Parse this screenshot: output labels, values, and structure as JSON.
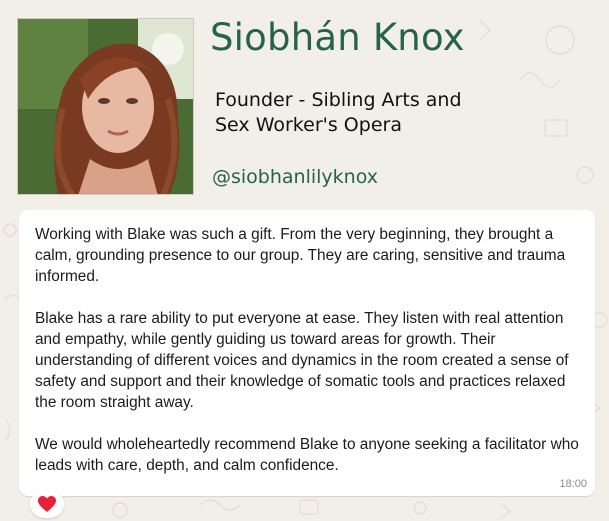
{
  "profile": {
    "name": "Siobhán Knox",
    "role_line1": "Founder - Sibling Arts and",
    "role_line2": "Sex Worker's Opera",
    "handle": "@siobhanlilyknox"
  },
  "message": {
    "paragraphs": [
      "Working with Blake was such a gift. From the very beginning, they brought a calm, grounding presence to our group. They are caring, sensitive and trauma informed.",
      "Blake has a rare ability to put everyone at ease. They listen with real attention and empathy, while gently guiding us toward areas for growth. Their understanding of different voices and dynamics in the room created a sense of safety and support and their knowledge of somatic tools and practices relaxed the room straight away.",
      "We would wholeheartedly recommend Blake to anyone seeking a facilitator who leads with care, depth, and calm confidence."
    ],
    "time": "18:00",
    "reaction_icon": "red-heart-icon"
  },
  "colors": {
    "accent": "#27624a",
    "background": "#f2efe9",
    "bubble": "#ffffff",
    "heart": "#e8203a"
  }
}
